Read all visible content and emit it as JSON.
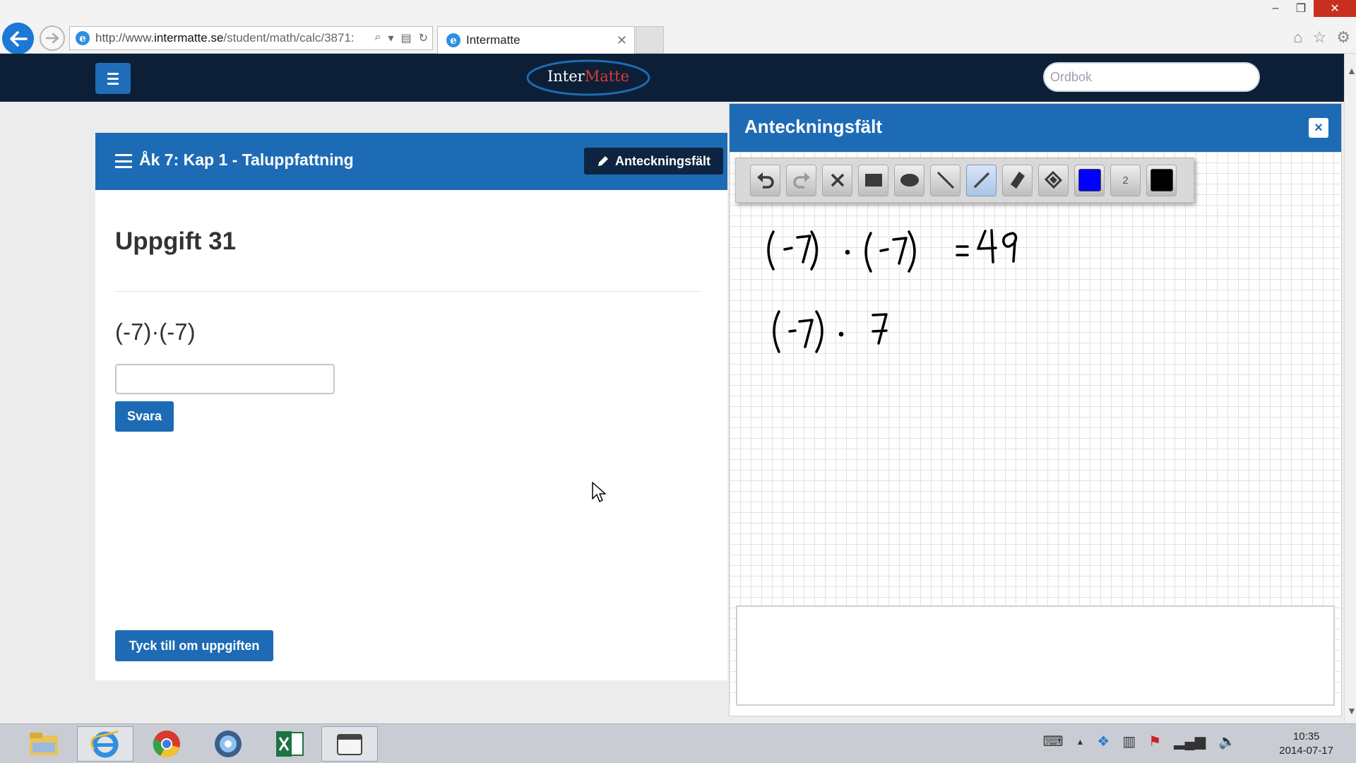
{
  "browser": {
    "url_prefix": "http://www.",
    "url_host": "intermatte.se",
    "url_rest": "/student/math/calc/3871:",
    "tab_title": "Intermatte"
  },
  "header": {
    "logo_inter": "Inter",
    "logo_matte": "Matte",
    "dictionary_placeholder": "Ordbok"
  },
  "main": {
    "chapter_title": "Åk 7: Kap 1 - Taluppfattning",
    "notes_button_label": "Anteckningsfält",
    "task_title": "Uppgift 31",
    "expression": "(-7)·(-7)",
    "answer_value": "",
    "submit_label": "Svara",
    "feedback_label": "Tyck till om uppgiften"
  },
  "notes_panel": {
    "title": "Anteckningsfält",
    "close_label": "×",
    "toolbar": {
      "tools": [
        "undo-icon",
        "redo-icon",
        "clear-icon",
        "rectangle-icon",
        "ellipse-icon",
        "line-icon",
        "pen-icon",
        "eraser-icon",
        "fill-icon"
      ],
      "active_tool": "pen-icon",
      "stroke_color": "#0000ff",
      "line_width": "2",
      "fill_color": "#000000"
    },
    "handwritten_lines": [
      "(-7) · (-7) = 49",
      "(-7) · 7"
    ],
    "text_value": ""
  },
  "taskbar": {
    "apps": [
      "file-explorer-icon",
      "internet-explorer-icon",
      "chrome-icon",
      "app-icon",
      "excel-icon",
      "video-editor-icon"
    ],
    "time": "10:35",
    "date": "2014-07-17"
  }
}
